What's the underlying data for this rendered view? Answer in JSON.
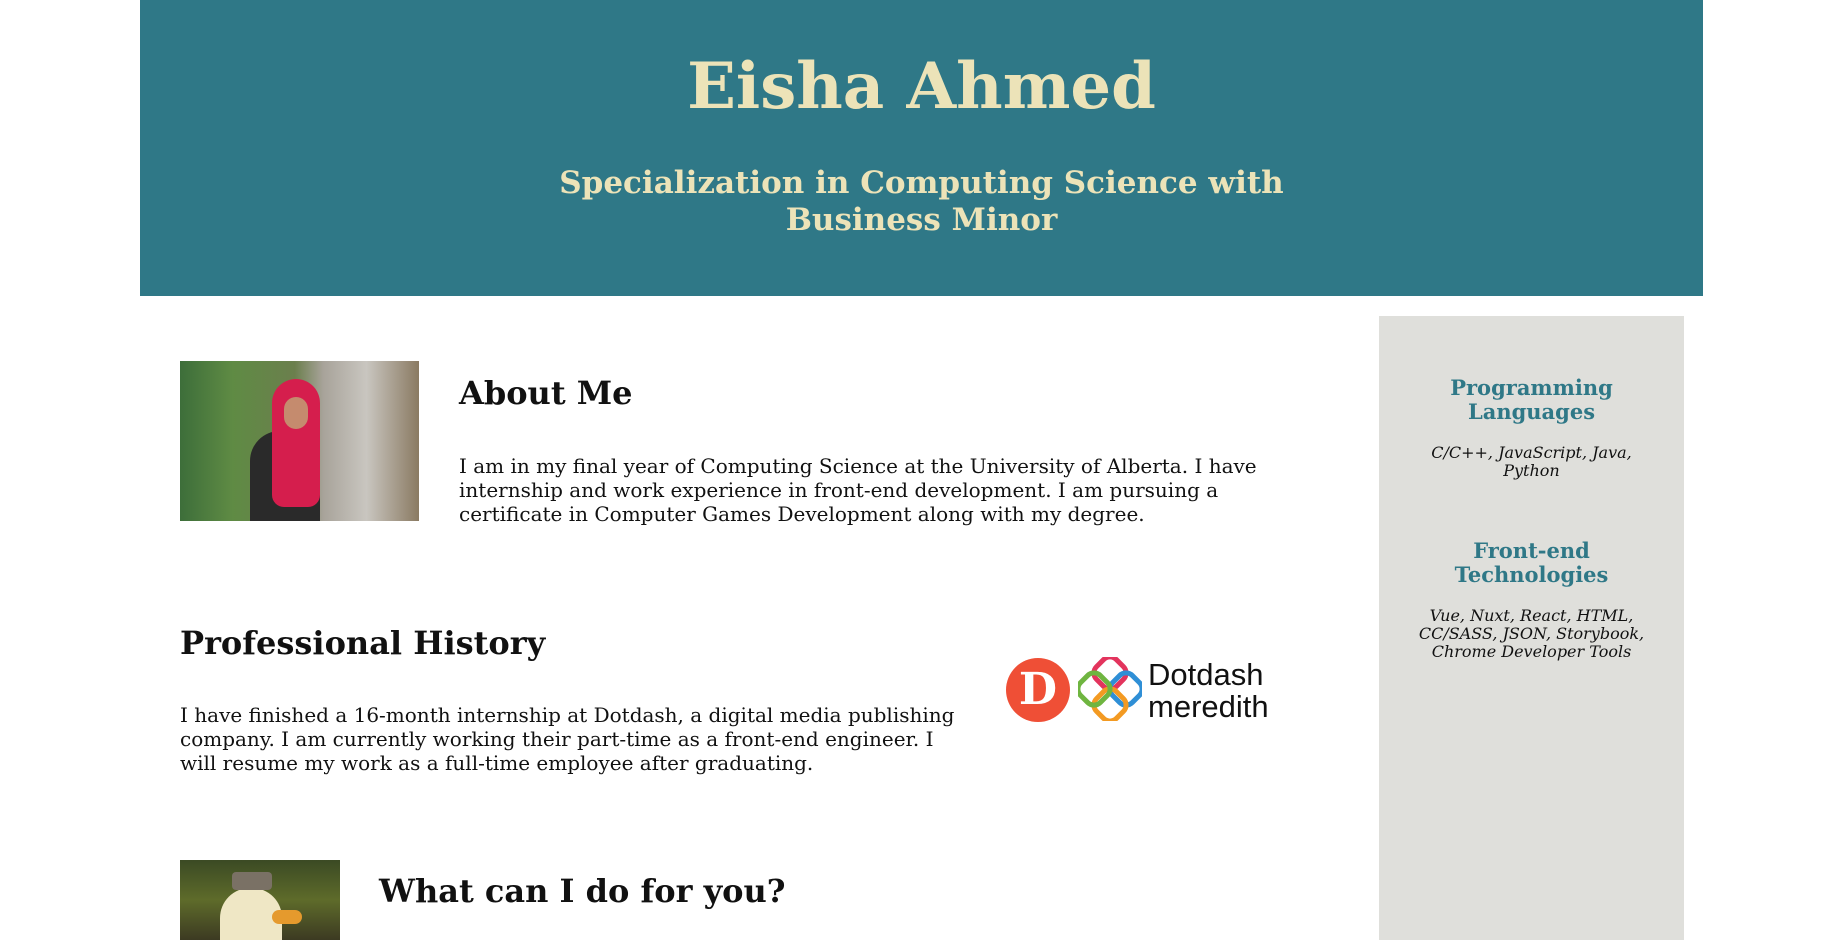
{
  "header": {
    "name": "Eisha Ahmed",
    "subtitle_line1": "Specialization in Computing Science with",
    "subtitle_line2": "Business Minor"
  },
  "about": {
    "title": "About Me",
    "text": "I am in my final year of Computing Science at the University of Alberta. I have internship and work experience in front-end development. I am pursuing a certificate in Computer Games Development along with my degree."
  },
  "history": {
    "title": "Professional History",
    "text": "I have finished a 16-month internship at Dotdash, a digital media publishing company. I am currently working their part-time as a front-end engineer. I will resume my work as a full-time employee after graduating."
  },
  "services": {
    "title": "What can I do for you?"
  },
  "logo": {
    "letter": "D",
    "word1": "Dotdash",
    "word2": "meredith"
  },
  "sidebar": {
    "programming_title_line1": "Programming",
    "programming_title_line2": "Languages",
    "programming_text": "C/C++, JavaScript, Java, Python",
    "frontend_title_line1": "Front-end",
    "frontend_title_line2": "Technologies",
    "frontend_text": "Vue, Nuxt, React, HTML, CC/SASS, JSON, Storybook, Chrome Developer Tools"
  },
  "colors": {
    "header_bg": "#2f7887",
    "header_text": "#ece3b8",
    "sidebar_bg": "#dfdfdb",
    "sidebar_title": "#2f7887"
  }
}
